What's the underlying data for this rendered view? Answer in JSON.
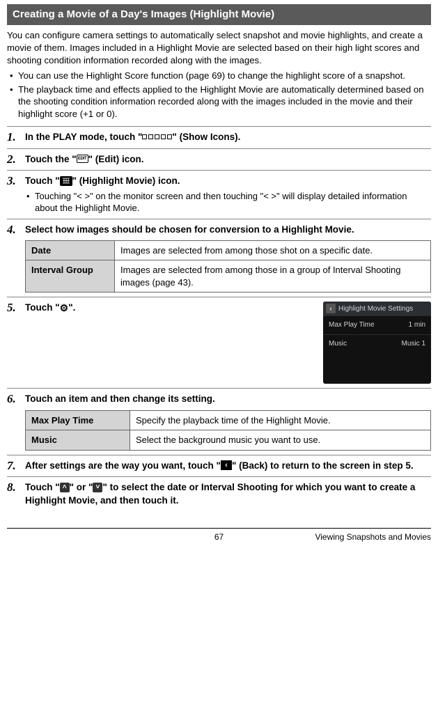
{
  "header": "Creating a Movie of a Day's Images (Highlight Movie)",
  "intro": "You can configure camera settings to automatically select snapshot and movie highlights, and create a movie of them. Images included in a Highlight Movie are selected based on their high light scores and shooting condition information recorded along with the images.",
  "notes": [
    "You can use the Highlight Score function (page 69) to change the highlight score of a snapshot.",
    "The playback time and effects applied to the Highlight Movie are automatically determined based on the shooting condition information recorded along with the images included in the movie and their highlight score (+1 or 0)."
  ],
  "steps": {
    "s1": {
      "num": "1.",
      "pre": "In the PLAY mode, touch \"",
      "post": "\" (Show Icons)."
    },
    "s2": {
      "num": "2.",
      "pre": "Touch the \"",
      "post": "\" (Edit) icon.",
      "iconText": "EDIT"
    },
    "s3": {
      "num": "3.",
      "pre": "Touch \"",
      "post": "\" (Highlight Movie) icon.",
      "sub": "Touching \"< >\" on the monitor screen and then touching \"< >\" will display detailed information about the Highlight Movie."
    },
    "s4": {
      "num": "4.",
      "title": "Select how images should be chosen for conversion to a Highlight Movie.",
      "rows": [
        {
          "label": "Date",
          "desc": "Images are selected from among those shot on a specific date."
        },
        {
          "label": "Interval Group",
          "desc": "Images are selected from among those in a group of Interval Shooting images (page 43)."
        }
      ]
    },
    "s5": {
      "num": "5.",
      "pre": "Touch \"",
      "post": "\".",
      "panel": {
        "title": "Highlight Movie Settings",
        "r1l": "Max Play Time",
        "r1v": "1 min",
        "r2l": "Music",
        "r2v": "Music 1"
      }
    },
    "s6": {
      "num": "6.",
      "title": "Touch an item and then change its setting.",
      "rows": [
        {
          "label": "Max Play Time",
          "desc": "Specify the playback time of the Highlight Movie."
        },
        {
          "label": "Music",
          "desc": "Select the background music you want to use."
        }
      ]
    },
    "s7": {
      "num": "7.",
      "pre": "After settings are the way you want, touch \"",
      "post": "\" (Back) to return to the screen in step 5."
    },
    "s8": {
      "num": "8.",
      "pre": "Touch \"",
      "mid": "\" or \"",
      "post": "\" to select the date or Interval Shooting for which you want to create a Highlight Movie, and then touch it."
    }
  },
  "footer": {
    "page": "67",
    "section": "Viewing Snapshots and Movies"
  }
}
